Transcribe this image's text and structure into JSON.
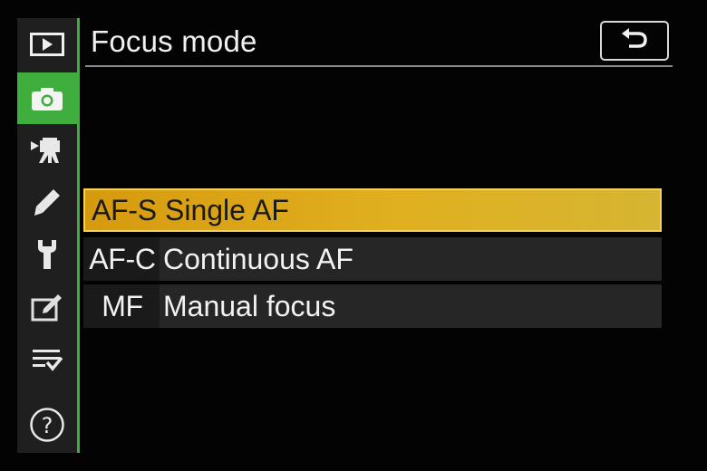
{
  "header": {
    "title": "Focus mode",
    "back_icon": "return-arrow-icon"
  },
  "sidebar": {
    "items": [
      {
        "icon": "playback-icon",
        "active": false
      },
      {
        "icon": "camera-icon",
        "active": true
      },
      {
        "icon": "movie-camera-icon",
        "active": false
      },
      {
        "icon": "pencil-icon",
        "active": false
      },
      {
        "icon": "wrench-icon",
        "active": false
      },
      {
        "icon": "retouch-icon",
        "active": false
      },
      {
        "icon": "my-menu-icon",
        "active": false
      },
      {
        "icon": "help-icon",
        "active": false,
        "label": "?"
      }
    ]
  },
  "menu": {
    "items": [
      {
        "code": "AF-S",
        "label": "Single AF",
        "selected": true
      },
      {
        "code": "AF-C",
        "label": "Continuous AF",
        "selected": false
      },
      {
        "code": "MF",
        "label": "Manual focus",
        "selected": false
      }
    ]
  },
  "colors": {
    "accent_green": "#3fae3f",
    "selection_yellow": "#e0b020",
    "row_bg": "#262626"
  }
}
